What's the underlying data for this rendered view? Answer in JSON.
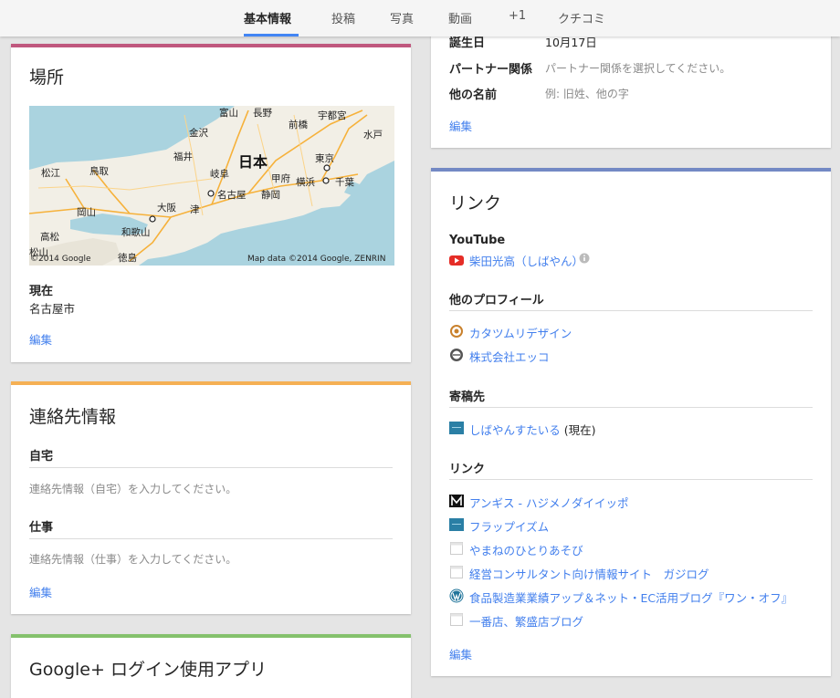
{
  "nav": {
    "tabs": [
      {
        "label": "基本情報"
      },
      {
        "label": "投稿"
      },
      {
        "label": "写真"
      },
      {
        "label": "動画"
      },
      {
        "label": "+1"
      },
      {
        "label": "クチコミ"
      }
    ]
  },
  "location": {
    "title": "場所",
    "map": {
      "center_label": "日本",
      "cities": [
        "富山",
        "長野",
        "前橋",
        "宇都宮",
        "金沢",
        "福井",
        "水戸",
        "東京",
        "松江",
        "鳥取",
        "岐阜",
        "甲府",
        "横浜",
        "千葉",
        "名古屋",
        "静岡",
        "岡山",
        "大阪",
        "津",
        "高松",
        "和歌山",
        "徳島",
        "松山"
      ],
      "credit_left": "©2014 Google",
      "credit_right": "Map data ©2014 Google, ZENRIN"
    },
    "current_label": "現在",
    "current_value": "名古屋市",
    "edit": "編集"
  },
  "contact": {
    "title": "連絡先情報",
    "home_label": "自宅",
    "home_hint": "連絡先情報（自宅）を入力してください。",
    "work_label": "仕事",
    "work_hint": "連絡先情報（仕事）を入力してください。",
    "edit": "編集"
  },
  "apps": {
    "title": "Google+ ログイン使用アプリ"
  },
  "basic": {
    "birthday_label": "誕生日",
    "birthday_value": "10月17日",
    "partner_label": "パートナー関係",
    "partner_hint": "パートナー関係を選択してください。",
    "othername_label": "他の名前",
    "othername_hint": "例: 旧姓、他の字",
    "edit": "編集"
  },
  "links": {
    "title": "リンク",
    "youtube_label": "YouTube",
    "youtube_link": "柴田光高（しばやん）",
    "other_profiles_label": "他のプロフィール",
    "other_profiles": [
      "カタツムリデザイン",
      "株式会社エッコ"
    ],
    "contributor_label": "寄稿先",
    "contributor_link": "しばやんすたいる",
    "contributor_suffix": " (現在)",
    "links_label": "リンク",
    "links": [
      "アンギス - ハジメノダイイッポ",
      "フラップイズム",
      "やまねのひとりあそび",
      "経営コンサルタント向け情報サイト　ガジログ",
      "食品製造業業績アップ＆ネット・EC活用ブログ『ワン・オフ』",
      "一番店、繁盛店ブログ"
    ],
    "edit": "編集"
  },
  "colors": {
    "location_bar": "#c0587e",
    "contact_bar": "#f5b054",
    "apps_bar": "#84c16c",
    "links_bar": "#7389c4",
    "link": "#427fed"
  }
}
